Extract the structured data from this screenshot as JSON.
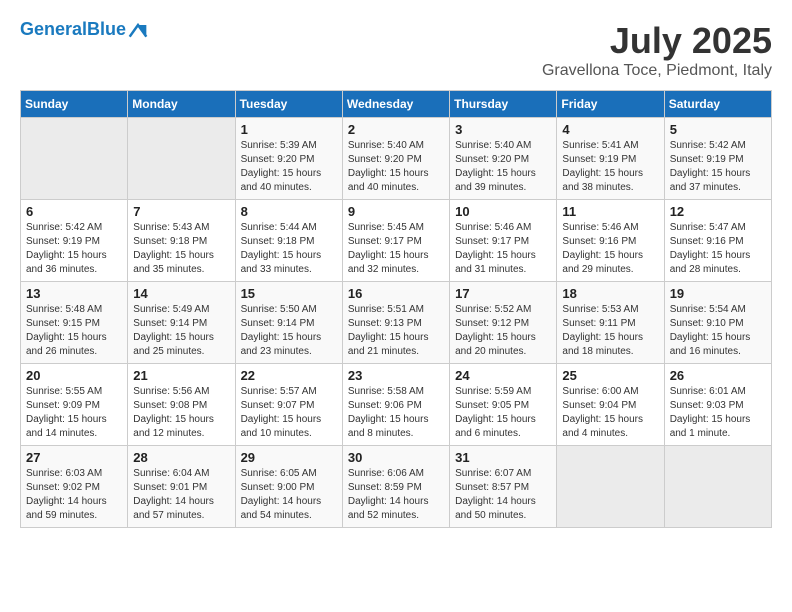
{
  "header": {
    "logo_line1": "General",
    "logo_line2": "Blue",
    "month": "July 2025",
    "location": "Gravellona Toce, Piedmont, Italy"
  },
  "days_of_week": [
    "Sunday",
    "Monday",
    "Tuesday",
    "Wednesday",
    "Thursday",
    "Friday",
    "Saturday"
  ],
  "weeks": [
    [
      {
        "day": "",
        "empty": true
      },
      {
        "day": "",
        "empty": true
      },
      {
        "day": "1",
        "sunrise": "Sunrise: 5:39 AM",
        "sunset": "Sunset: 9:20 PM",
        "daylight": "Daylight: 15 hours and 40 minutes."
      },
      {
        "day": "2",
        "sunrise": "Sunrise: 5:40 AM",
        "sunset": "Sunset: 9:20 PM",
        "daylight": "Daylight: 15 hours and 40 minutes."
      },
      {
        "day": "3",
        "sunrise": "Sunrise: 5:40 AM",
        "sunset": "Sunset: 9:20 PM",
        "daylight": "Daylight: 15 hours and 39 minutes."
      },
      {
        "day": "4",
        "sunrise": "Sunrise: 5:41 AM",
        "sunset": "Sunset: 9:19 PM",
        "daylight": "Daylight: 15 hours and 38 minutes."
      },
      {
        "day": "5",
        "sunrise": "Sunrise: 5:42 AM",
        "sunset": "Sunset: 9:19 PM",
        "daylight": "Daylight: 15 hours and 37 minutes."
      }
    ],
    [
      {
        "day": "6",
        "sunrise": "Sunrise: 5:42 AM",
        "sunset": "Sunset: 9:19 PM",
        "daylight": "Daylight: 15 hours and 36 minutes."
      },
      {
        "day": "7",
        "sunrise": "Sunrise: 5:43 AM",
        "sunset": "Sunset: 9:18 PM",
        "daylight": "Daylight: 15 hours and 35 minutes."
      },
      {
        "day": "8",
        "sunrise": "Sunrise: 5:44 AM",
        "sunset": "Sunset: 9:18 PM",
        "daylight": "Daylight: 15 hours and 33 minutes."
      },
      {
        "day": "9",
        "sunrise": "Sunrise: 5:45 AM",
        "sunset": "Sunset: 9:17 PM",
        "daylight": "Daylight: 15 hours and 32 minutes."
      },
      {
        "day": "10",
        "sunrise": "Sunrise: 5:46 AM",
        "sunset": "Sunset: 9:17 PM",
        "daylight": "Daylight: 15 hours and 31 minutes."
      },
      {
        "day": "11",
        "sunrise": "Sunrise: 5:46 AM",
        "sunset": "Sunset: 9:16 PM",
        "daylight": "Daylight: 15 hours and 29 minutes."
      },
      {
        "day": "12",
        "sunrise": "Sunrise: 5:47 AM",
        "sunset": "Sunset: 9:16 PM",
        "daylight": "Daylight: 15 hours and 28 minutes."
      }
    ],
    [
      {
        "day": "13",
        "sunrise": "Sunrise: 5:48 AM",
        "sunset": "Sunset: 9:15 PM",
        "daylight": "Daylight: 15 hours and 26 minutes."
      },
      {
        "day": "14",
        "sunrise": "Sunrise: 5:49 AM",
        "sunset": "Sunset: 9:14 PM",
        "daylight": "Daylight: 15 hours and 25 minutes."
      },
      {
        "day": "15",
        "sunrise": "Sunrise: 5:50 AM",
        "sunset": "Sunset: 9:14 PM",
        "daylight": "Daylight: 15 hours and 23 minutes."
      },
      {
        "day": "16",
        "sunrise": "Sunrise: 5:51 AM",
        "sunset": "Sunset: 9:13 PM",
        "daylight": "Daylight: 15 hours and 21 minutes."
      },
      {
        "day": "17",
        "sunrise": "Sunrise: 5:52 AM",
        "sunset": "Sunset: 9:12 PM",
        "daylight": "Daylight: 15 hours and 20 minutes."
      },
      {
        "day": "18",
        "sunrise": "Sunrise: 5:53 AM",
        "sunset": "Sunset: 9:11 PM",
        "daylight": "Daylight: 15 hours and 18 minutes."
      },
      {
        "day": "19",
        "sunrise": "Sunrise: 5:54 AM",
        "sunset": "Sunset: 9:10 PM",
        "daylight": "Daylight: 15 hours and 16 minutes."
      }
    ],
    [
      {
        "day": "20",
        "sunrise": "Sunrise: 5:55 AM",
        "sunset": "Sunset: 9:09 PM",
        "daylight": "Daylight: 15 hours and 14 minutes."
      },
      {
        "day": "21",
        "sunrise": "Sunrise: 5:56 AM",
        "sunset": "Sunset: 9:08 PM",
        "daylight": "Daylight: 15 hours and 12 minutes."
      },
      {
        "day": "22",
        "sunrise": "Sunrise: 5:57 AM",
        "sunset": "Sunset: 9:07 PM",
        "daylight": "Daylight: 15 hours and 10 minutes."
      },
      {
        "day": "23",
        "sunrise": "Sunrise: 5:58 AM",
        "sunset": "Sunset: 9:06 PM",
        "daylight": "Daylight: 15 hours and 8 minutes."
      },
      {
        "day": "24",
        "sunrise": "Sunrise: 5:59 AM",
        "sunset": "Sunset: 9:05 PM",
        "daylight": "Daylight: 15 hours and 6 minutes."
      },
      {
        "day": "25",
        "sunrise": "Sunrise: 6:00 AM",
        "sunset": "Sunset: 9:04 PM",
        "daylight": "Daylight: 15 hours and 4 minutes."
      },
      {
        "day": "26",
        "sunrise": "Sunrise: 6:01 AM",
        "sunset": "Sunset: 9:03 PM",
        "daylight": "Daylight: 15 hours and 1 minute."
      }
    ],
    [
      {
        "day": "27",
        "sunrise": "Sunrise: 6:03 AM",
        "sunset": "Sunset: 9:02 PM",
        "daylight": "Daylight: 14 hours and 59 minutes."
      },
      {
        "day": "28",
        "sunrise": "Sunrise: 6:04 AM",
        "sunset": "Sunset: 9:01 PM",
        "daylight": "Daylight: 14 hours and 57 minutes."
      },
      {
        "day": "29",
        "sunrise": "Sunrise: 6:05 AM",
        "sunset": "Sunset: 9:00 PM",
        "daylight": "Daylight: 14 hours and 54 minutes."
      },
      {
        "day": "30",
        "sunrise": "Sunrise: 6:06 AM",
        "sunset": "Sunset: 8:59 PM",
        "daylight": "Daylight: 14 hours and 52 minutes."
      },
      {
        "day": "31",
        "sunrise": "Sunrise: 6:07 AM",
        "sunset": "Sunset: 8:57 PM",
        "daylight": "Daylight: 14 hours and 50 minutes."
      },
      {
        "day": "",
        "empty": true
      },
      {
        "day": "",
        "empty": true
      }
    ]
  ]
}
